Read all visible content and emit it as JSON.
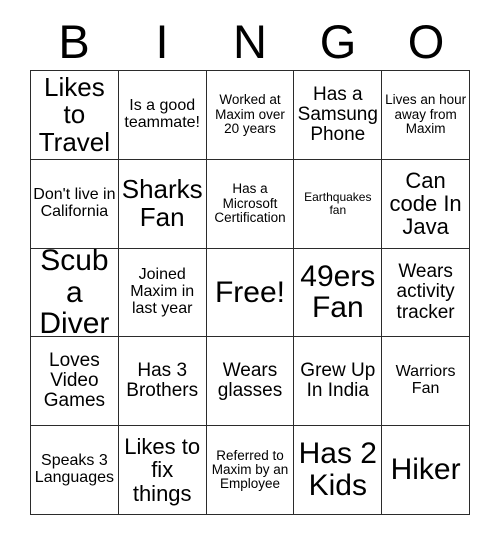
{
  "card": {
    "title": "BINGO",
    "header_letters": [
      "B",
      "I",
      "N",
      "G",
      "O"
    ],
    "free_space_label": "Free!",
    "grid_size": "5x5",
    "colors": {
      "background": "#ffffff",
      "border": "#2b2b2b",
      "text": "#000000"
    },
    "rows": [
      [
        {
          "text": "Likes to Travel",
          "size": "xl"
        },
        {
          "text": "Is a good teammate!",
          "size": "sm"
        },
        {
          "text": "Worked at Maxim over 20 years",
          "size": "xs"
        },
        {
          "text": "Has a Samsung Phone",
          "size": "md"
        },
        {
          "text": "Lives an hour away from Maxim",
          "size": "xs"
        }
      ],
      [
        {
          "text": "Don't live in California",
          "size": "sm"
        },
        {
          "text": "Sharks Fan",
          "size": "xl"
        },
        {
          "text": "Has a Microsoft Certification",
          "size": "xs"
        },
        {
          "text": "Earthquakes fan",
          "size": "xxs"
        },
        {
          "text": "Can code In Java",
          "size": "lg"
        }
      ],
      [
        {
          "text": "Scuba Diver",
          "size": "xxl"
        },
        {
          "text": "Joined Maxim in last year",
          "size": "sm"
        },
        {
          "text": "Free!",
          "size": "xxl"
        },
        {
          "text": "49ers Fan",
          "size": "xxl"
        },
        {
          "text": "Wears activity tracker",
          "size": "md"
        }
      ],
      [
        {
          "text": "Loves Video Games",
          "size": "md"
        },
        {
          "text": "Has 3 Brothers",
          "size": "md"
        },
        {
          "text": "Wears glasses",
          "size": "md"
        },
        {
          "text": "Grew Up In India",
          "size": "md"
        },
        {
          "text": "Warriors Fan",
          "size": "sm"
        }
      ],
      [
        {
          "text": "Speaks 3 Languages",
          "size": "sm"
        },
        {
          "text": "Likes to fix things",
          "size": "lg"
        },
        {
          "text": "Referred to Maxim by an Employee",
          "size": "xs"
        },
        {
          "text": "Has 2 Kids",
          "size": "xxl"
        },
        {
          "text": "Hiker",
          "size": "xxl"
        }
      ]
    ]
  }
}
